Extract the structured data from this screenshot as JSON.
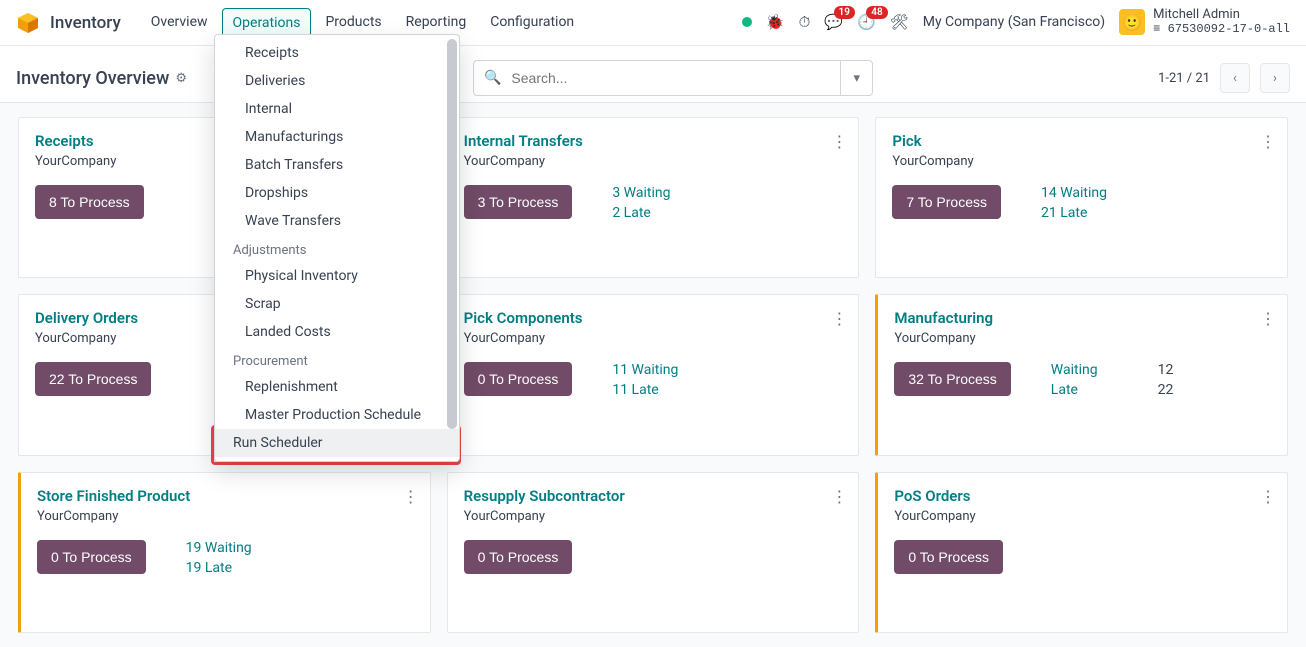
{
  "nav": {
    "app": "Inventory",
    "items": [
      "Overview",
      "Operations",
      "Products",
      "Reporting",
      "Configuration"
    ],
    "active_index": 1,
    "badge_chat": "19",
    "badge_cal": "48",
    "company": "My Company (San Francisco)",
    "user_name": "Mitchell Admin",
    "db_name": "67530092-17-0-all"
  },
  "control": {
    "breadcrumb": "Inventory Overview",
    "search_placeholder": "Search...",
    "pager": "1-21 / 21"
  },
  "dropdown": {
    "sections": [
      {
        "header": null,
        "items": [
          "Receipts",
          "Deliveries",
          "Internal",
          "Manufacturings",
          "Batch Transfers",
          "Dropships",
          "Wave Transfers"
        ]
      },
      {
        "header": "Adjustments",
        "items": [
          "Physical Inventory",
          "Scrap",
          "Landed Costs"
        ]
      },
      {
        "header": "Procurement",
        "items": [
          "Replenishment",
          "Master Production Schedule"
        ]
      },
      {
        "header": null,
        "items": [
          "Run Scheduler"
        ],
        "highlight": true
      }
    ]
  },
  "cards": [
    {
      "title": "Receipts",
      "sub": "YourCompany",
      "btn": "8 To Process",
      "stats": [],
      "accent": false
    },
    {
      "title": "Internal Transfers",
      "sub": "YourCompany",
      "btn": "3 To Process",
      "stats": [
        {
          "label": "3 Waiting"
        },
        {
          "label": "2 Late"
        }
      ],
      "accent": false
    },
    {
      "title": "Pick",
      "sub": "YourCompany",
      "btn": "7 To Process",
      "stats": [
        {
          "label": "14 Waiting"
        },
        {
          "label": "21 Late"
        }
      ],
      "accent": false
    },
    {
      "title": "Delivery Orders",
      "sub": "YourCompany",
      "btn": "22 To Process",
      "stats": [],
      "accent": false
    },
    {
      "title": "Pick Components",
      "sub": "YourCompany",
      "btn": "0 To Process",
      "stats": [
        {
          "label": "11 Waiting"
        },
        {
          "label": "11 Late"
        }
      ],
      "accent": false
    },
    {
      "title": "Manufacturing",
      "sub": "YourCompany",
      "btn": "32 To Process",
      "table": [
        {
          "lbl": "Waiting",
          "num": "12"
        },
        {
          "lbl": "Late",
          "num": "22"
        }
      ],
      "accent": true
    },
    {
      "title": "Store Finished Product",
      "sub": "YourCompany",
      "btn": "0 To Process",
      "stats": [
        {
          "label": "19 Waiting"
        },
        {
          "label": "19 Late"
        }
      ],
      "accent": true
    },
    {
      "title": "Resupply Subcontractor",
      "sub": "YourCompany",
      "btn": "0 To Process",
      "stats": [],
      "accent": false
    },
    {
      "title": "PoS Orders",
      "sub": "YourCompany",
      "btn": "0 To Process",
      "stats": [],
      "accent": true
    }
  ]
}
